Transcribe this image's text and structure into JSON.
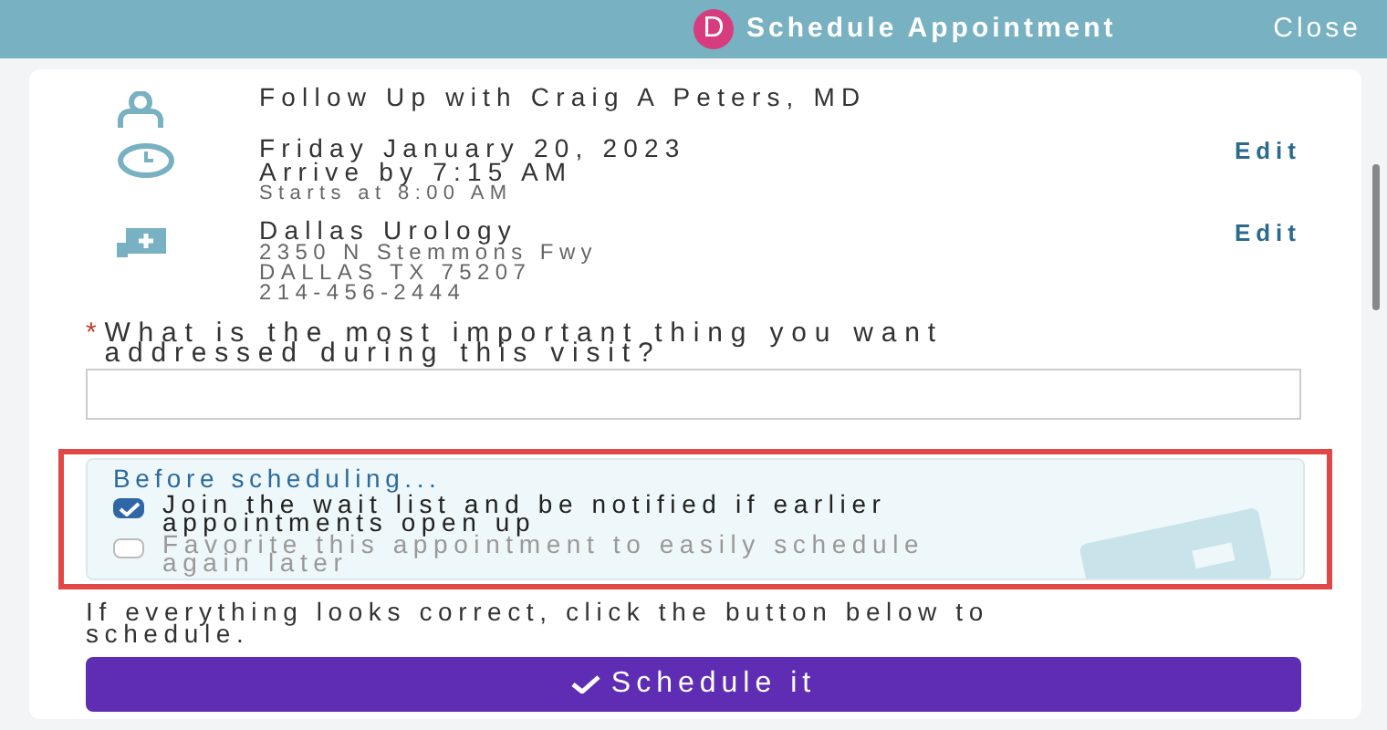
{
  "header": {
    "avatar": "D",
    "title": "Schedule Appointment",
    "close": "Close"
  },
  "details": [
    {
      "kind": "provider",
      "lines": [
        "Follow Up with Craig A Peters, MD"
      ]
    },
    {
      "kind": "time",
      "lines": [
        "Friday January 20, 2023",
        "Arrive by 7:15 AM"
      ],
      "note": "Starts at 8:00 AM",
      "action": "Edit"
    },
    {
      "kind": "location",
      "lines": [
        "Dallas Urology"
      ],
      "sub_lines": [
        "2350 N Stemmons Fwy",
        "DALLAS TX 75207",
        "214-456-2444"
      ],
      "action": "Edit"
    }
  ],
  "question": {
    "required_mark": "*",
    "label": "What is the most important thing you want addressed during this visit?"
  },
  "options": {
    "title": "Before scheduling...",
    "items": [
      {
        "label": "Join the wait list and be notified if earlier appointments open up",
        "checked": true
      },
      {
        "label": "Favorite this appointment to easily schedule again later",
        "checked": false
      }
    ]
  },
  "footer_text": "If everything looks correct, click the button below to schedule.",
  "submit": "Schedule it"
}
